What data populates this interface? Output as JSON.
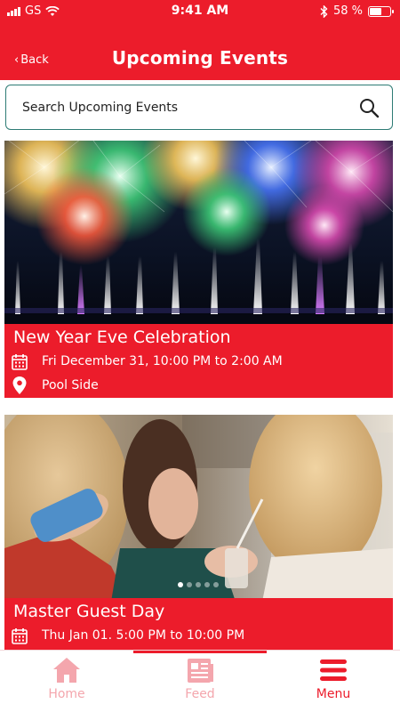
{
  "status_bar": {
    "carrier": "GS",
    "time": "9:41 AM",
    "battery_percent": "58 %",
    "battery_level": 0.58
  },
  "nav": {
    "back_label": "Back",
    "title": "Upcoming Events"
  },
  "search": {
    "placeholder": "Search Upcoming Events",
    "icon": "search-icon"
  },
  "events": [
    {
      "title": "New Year Eve Celebration",
      "datetime": "Fri December 31, 10:00 PM to 2:00 AM",
      "location": "Pool Side",
      "image": "fireworks-over-lake"
    },
    {
      "title": "Master Guest Day",
      "datetime": "Thu Jan 01. 5:00 PM to 10:00 PM",
      "image": "women-looking-at-phone",
      "carousel_dots": 5,
      "carousel_active": 1
    }
  ],
  "tabs": [
    {
      "label": "Home",
      "icon": "home-icon",
      "active": false
    },
    {
      "label": "Feed",
      "icon": "feed-icon",
      "active": false
    },
    {
      "label": "Menu",
      "icon": "menu-icon",
      "active": true
    }
  ],
  "colors": {
    "primary": "#ec1c2b",
    "inactive_tab": "#f4a6ad",
    "search_border": "#2d7b74"
  }
}
